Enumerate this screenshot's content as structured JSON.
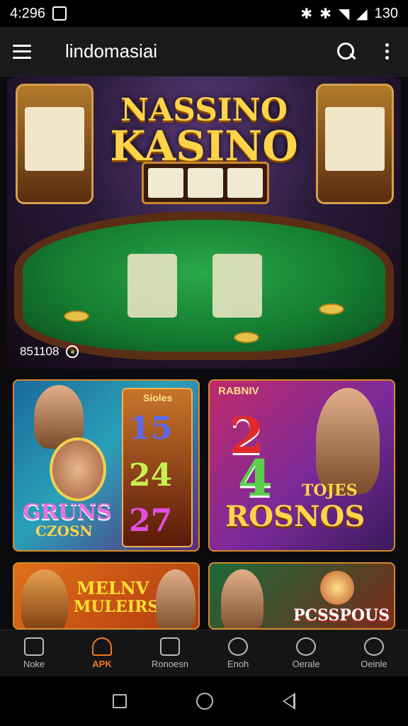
{
  "status_bar": {
    "time": "4:296",
    "battery_text": "130"
  },
  "app_bar": {
    "title": "lindomasiai"
  },
  "hero": {
    "title_line1": "NASSINO",
    "title_line2": "KASINO",
    "footer_text": "851108"
  },
  "tiles": [
    {
      "big_text": "GRUNS",
      "sub_text": "CZOSN",
      "corner_text": "Sioles",
      "numbers": [
        "15",
        "24",
        "27"
      ]
    },
    {
      "corner_text": "RABNIV",
      "numbers": [
        "2",
        "4"
      ],
      "big_text": "ROSNOS",
      "sub_text": "TOJES"
    },
    {
      "big_text": "MELNV",
      "sub_text": "MULEIRS"
    },
    {
      "big_text": "PCSSPOUS"
    }
  ],
  "bottom_nav": [
    {
      "label": "Noke",
      "icon": "home-icon"
    },
    {
      "label": "APK",
      "icon": "apk-icon",
      "active": true
    },
    {
      "label": "Ronoesn",
      "icon": "card-icon"
    },
    {
      "label": "Enoh",
      "icon": "clock-icon"
    },
    {
      "label": "Oerale",
      "icon": "refresh-icon"
    },
    {
      "label": "Oeinle",
      "icon": "search-icon"
    }
  ],
  "colors": {
    "accent": "#f07a1a",
    "gold": "#ffd34a"
  }
}
